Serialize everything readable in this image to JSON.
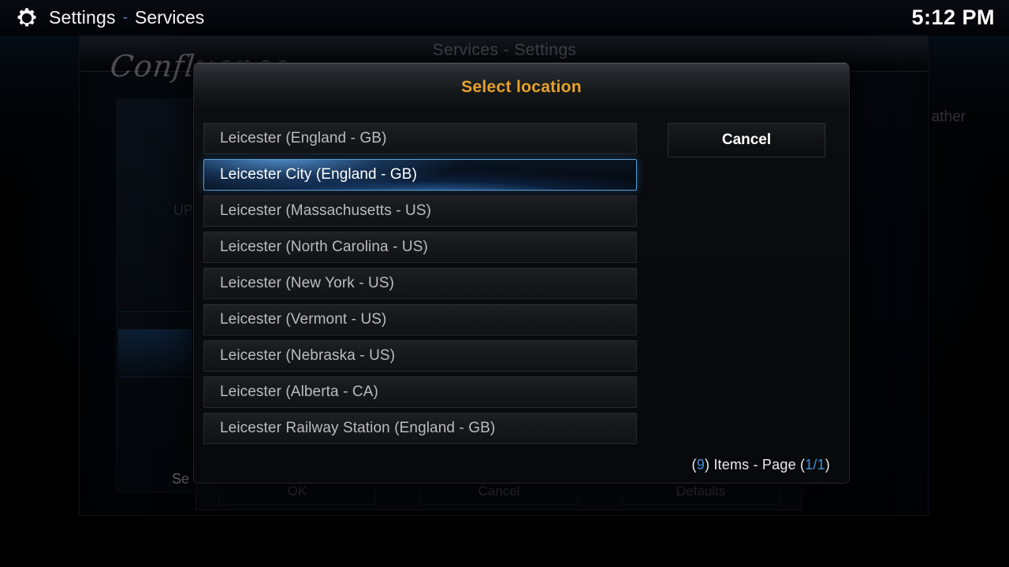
{
  "topbar": {
    "icon": "gear-icon",
    "title": "Settings",
    "separator": "-",
    "subtitle": "Services",
    "clock": "5:12 PM"
  },
  "background": {
    "window_title": "Services - Settings",
    "skin_logo": "Confluence",
    "right_label": "ather",
    "mid_label": "UP",
    "left_label": "Se",
    "buttons": [
      {
        "label": "OK"
      },
      {
        "label": "Cancel"
      },
      {
        "label": "Defaults"
      }
    ]
  },
  "dialog": {
    "title": "Select location",
    "items": [
      {
        "label": "Leicester (England - GB)",
        "selected": false
      },
      {
        "label": "Leicester City (England - GB)",
        "selected": true
      },
      {
        "label": "Leicester (Massachusetts - US)",
        "selected": false
      },
      {
        "label": "Leicester (North Carolina - US)",
        "selected": false
      },
      {
        "label": "Leicester (New York - US)",
        "selected": false
      },
      {
        "label": "Leicester (Vermont - US)",
        "selected": false
      },
      {
        "label": "Leicester (Nebraska - US)",
        "selected": false
      },
      {
        "label": "Leicester (Alberta - CA)",
        "selected": false
      },
      {
        "label": "Leicester Railway Station (England - GB)",
        "selected": false
      }
    ],
    "cancel_label": "Cancel",
    "pager": {
      "open_paren": "(",
      "item_count": "9",
      "mid_text": ") Items - Page (",
      "page": "1/1",
      "close_paren": ")"
    }
  },
  "colors": {
    "accent_title": "#e8a12a",
    "highlight_blue": "#3f8fdc",
    "selected_border": "#5a9fd4",
    "text_primary": "#ffffff",
    "text_secondary": "#b9bcc1"
  }
}
